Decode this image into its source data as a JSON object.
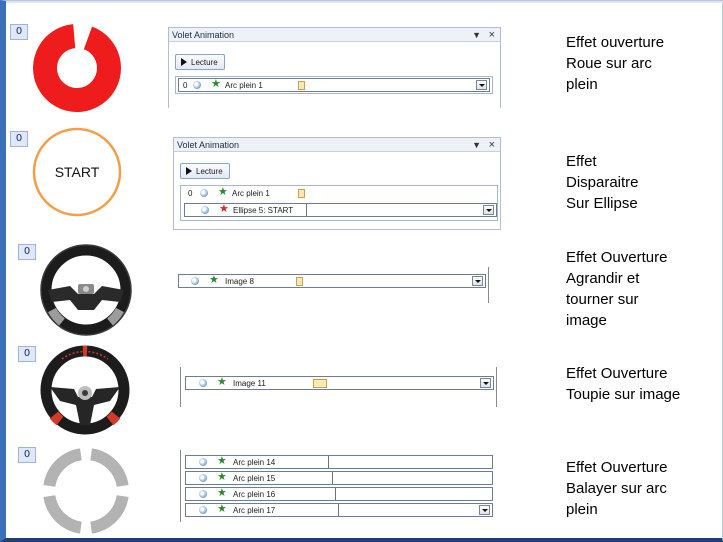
{
  "sections": [
    {
      "badge": "0",
      "description": [
        "Effet ouverture",
        "Roue sur arc",
        "plein"
      ],
      "panel": {
        "title": "Volet Animation",
        "play_label": "Lecture",
        "rows": [
          {
            "number": "0",
            "label": "Arc plein 1"
          }
        ]
      }
    },
    {
      "badge": "0",
      "shape_text": "START",
      "description": [
        "Effet",
        "Disparaitre",
        "Sur Ellipse"
      ],
      "panel": {
        "title": "Volet Animation",
        "play_label": "Lecture",
        "rows": [
          {
            "number": "0",
            "label": "Arc plein 1"
          },
          {
            "number": "",
            "label": "Ellipse 5: START"
          }
        ]
      }
    },
    {
      "badge": "0",
      "description": [
        "Effet Ouverture",
        "Agrandir et",
        "tourner sur",
        "image"
      ],
      "panel": {
        "rows": [
          {
            "label": "Image 8"
          }
        ]
      }
    },
    {
      "badge": "0",
      "description": [
        "Effet Ouverture",
        "Toupie sur image"
      ],
      "panel": {
        "rows": [
          {
            "label": "Image 11"
          }
        ]
      }
    },
    {
      "badge": "0",
      "description": [
        "Effet Ouverture",
        "Balayer sur arc",
        "plein"
      ],
      "panel": {
        "rows": [
          {
            "label": "Arc plein 14"
          },
          {
            "label": "Arc plein 15"
          },
          {
            "label": "Arc plein 16"
          },
          {
            "label": "Arc plein 17"
          }
        ]
      }
    }
  ],
  "colors": {
    "red_arc": "#ee1c1c",
    "orange_ring": "#f0a048",
    "grey_arc": "#b3b3b3",
    "accent_border": "#3d6fb8",
    "exit_star": "#d42a2a",
    "entrance_star": "#2b8a2b"
  },
  "icons": {
    "close": "×",
    "dropdown": "▼",
    "entrance_effect": "entrance-star-icon",
    "exit_effect": "exit-star-icon",
    "timing": "clock-icon"
  }
}
